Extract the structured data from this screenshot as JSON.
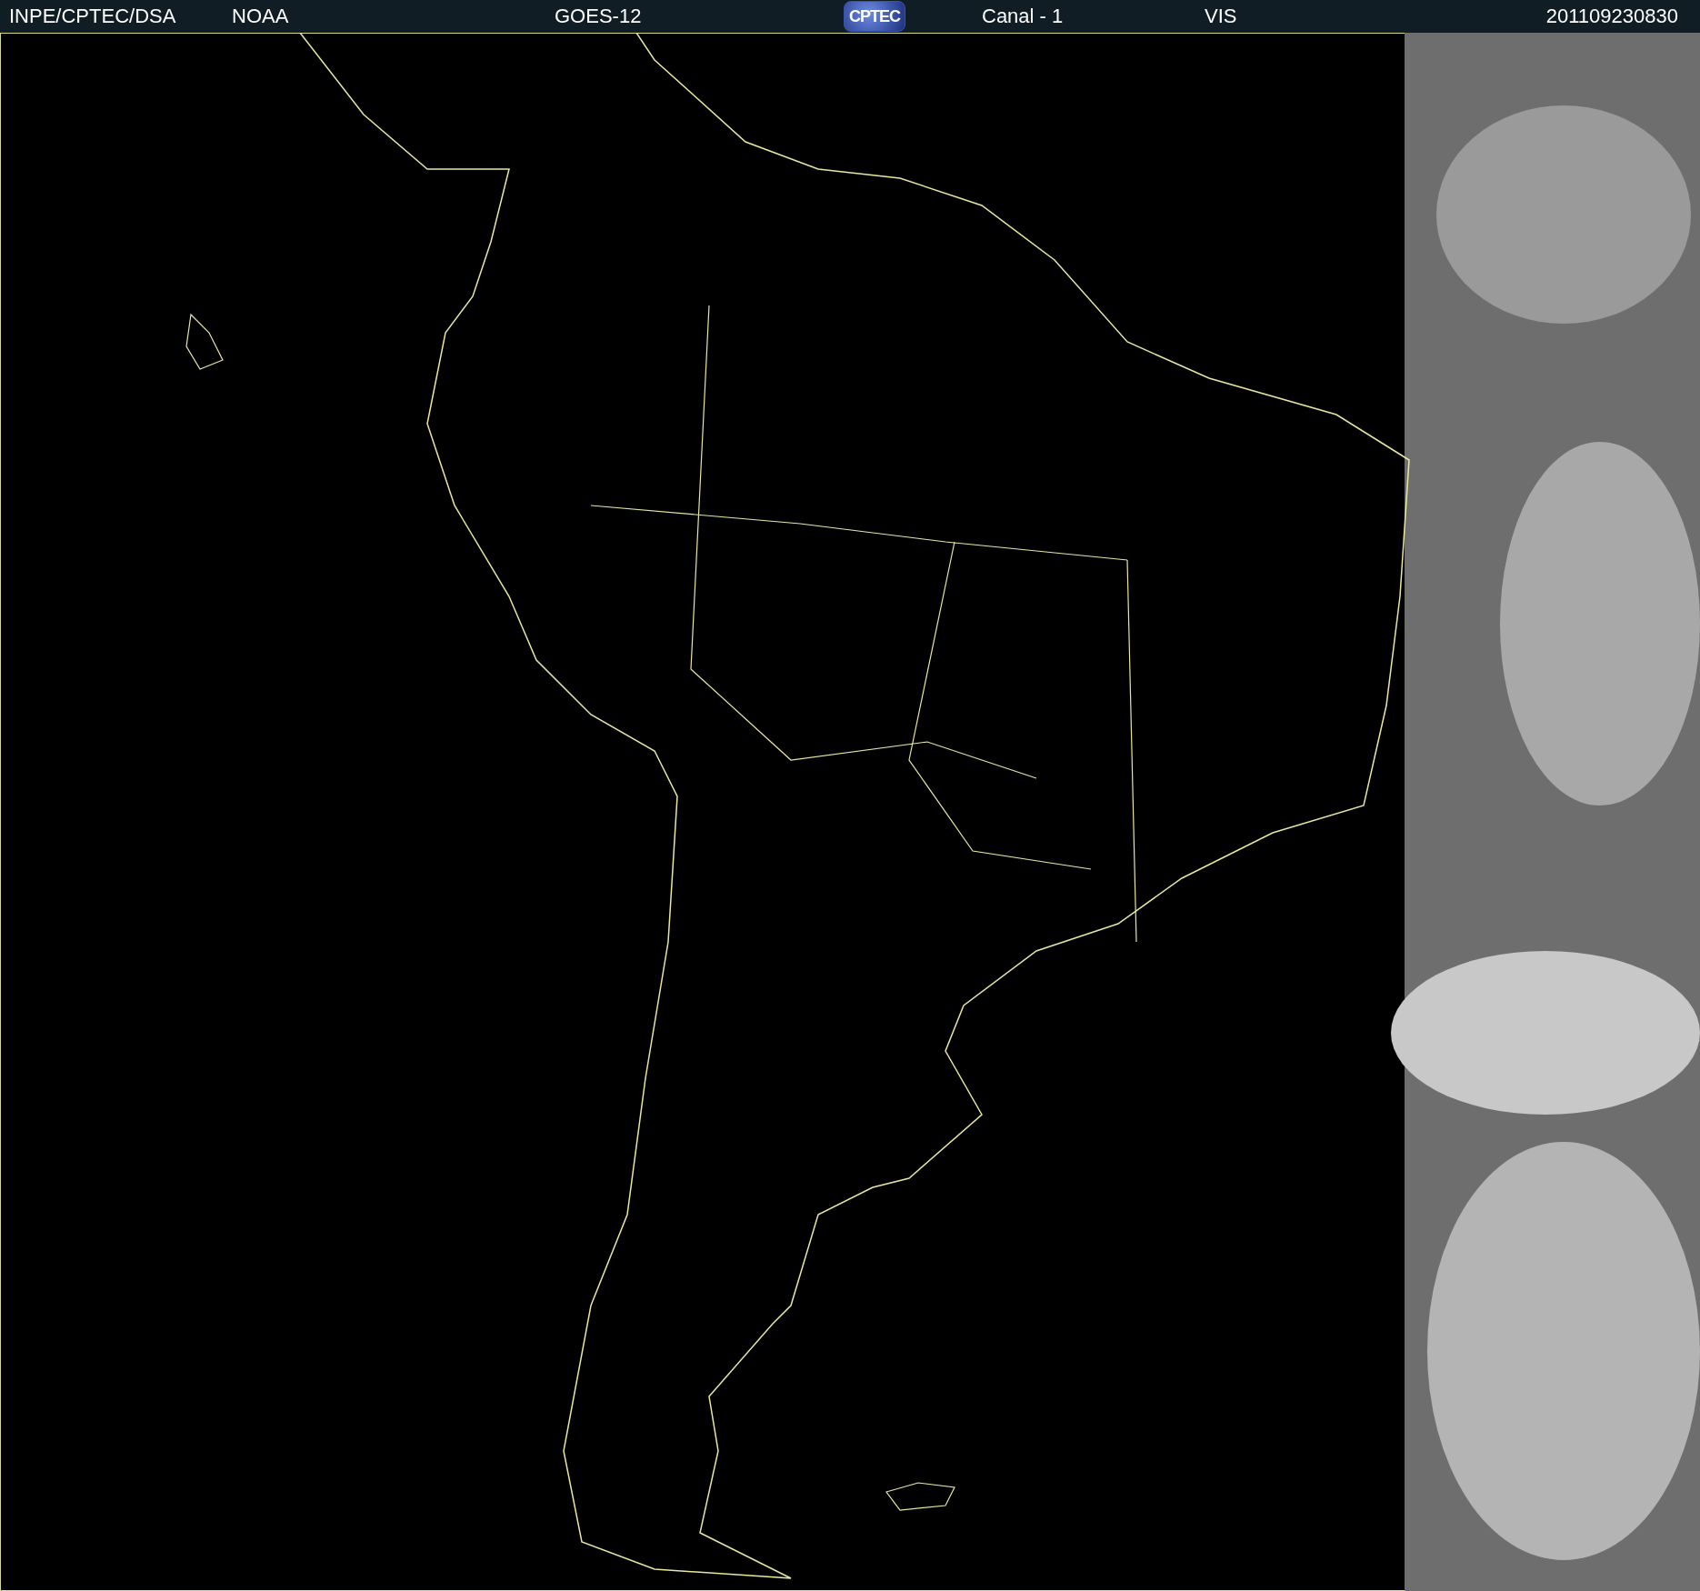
{
  "header": {
    "items": [
      {
        "kind": "text",
        "text": "INPE/CPTEC/DSA"
      },
      {
        "kind": "text",
        "text": "NOAA"
      },
      {
        "kind": "text",
        "text": "GOES-12"
      },
      {
        "kind": "logo",
        "text": "CPTEC"
      },
      {
        "kind": "text",
        "text": "Canal - 1"
      },
      {
        "kind": "text",
        "text": "VIS"
      },
      {
        "kind": "text",
        "text": "201109230830"
      }
    ]
  }
}
